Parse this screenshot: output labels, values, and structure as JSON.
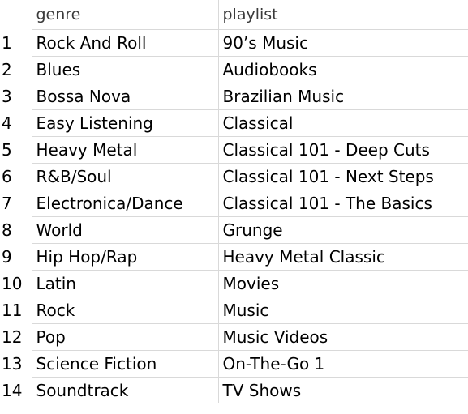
{
  "table": {
    "columns": [
      "",
      "genre",
      "playlist"
    ],
    "rows": [
      {
        "index": "1",
        "genre": "Rock And Roll",
        "playlist": "90’s Music"
      },
      {
        "index": "2",
        "genre": "Blues",
        "playlist": "Audiobooks"
      },
      {
        "index": "3",
        "genre": "Bossa Nova",
        "playlist": "Brazilian Music"
      },
      {
        "index": "4",
        "genre": "Easy Listening",
        "playlist": "Classical"
      },
      {
        "index": "5",
        "genre": "Heavy Metal",
        "playlist": "Classical 101 - Deep Cuts"
      },
      {
        "index": "6",
        "genre": "R&B/Soul",
        "playlist": "Classical 101 - Next Steps"
      },
      {
        "index": "7",
        "genre": "Electronica/Dance",
        "playlist": "Classical 101 - The Basics"
      },
      {
        "index": "8",
        "genre": "World",
        "playlist": "Grunge"
      },
      {
        "index": "9",
        "genre": "Hip Hop/Rap",
        "playlist": "Heavy Metal Classic"
      },
      {
        "index": "10",
        "genre": "Latin",
        "playlist": "Movies"
      },
      {
        "index": "11",
        "genre": "Rock",
        "playlist": "Music"
      },
      {
        "index": "12",
        "genre": "Pop",
        "playlist": "Music Videos"
      },
      {
        "index": "13",
        "genre": "Science Fiction",
        "playlist": "On-The-Go 1"
      },
      {
        "index": "14",
        "genre": "Soundtrack",
        "playlist": "TV Shows"
      }
    ]
  }
}
